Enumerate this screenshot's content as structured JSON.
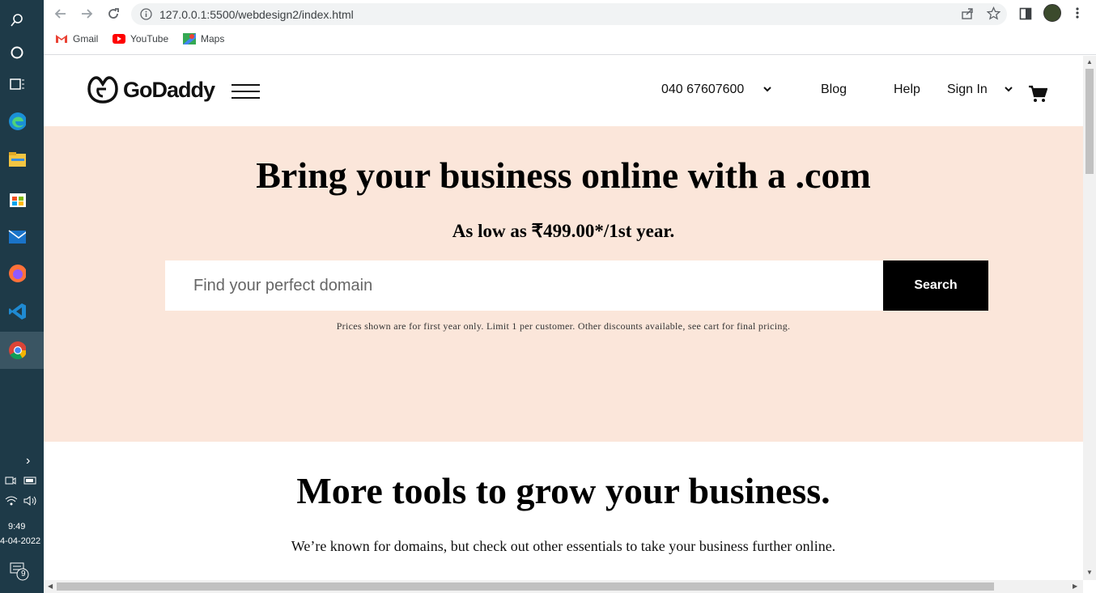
{
  "taskbar": {
    "time": "9:49",
    "date": "4-04-2022",
    "notification_count": "9"
  },
  "browser": {
    "url": "127.0.0.1:5500/webdesign2/index.html",
    "bookmarks": [
      {
        "label": "Gmail"
      },
      {
        "label": "YouTube"
      },
      {
        "label": "Maps"
      }
    ]
  },
  "header": {
    "logo": "GoDaddy",
    "phone": "040 67607600",
    "blog": "Blog",
    "help": "Help",
    "signin": "Sign In"
  },
  "hero": {
    "title": "Bring your business online with a .com",
    "subtitle": "As low as ₹499.00*/1st year.",
    "search_placeholder": "Find your perfect domain",
    "search_button": "Search",
    "disclaimer": "Prices shown are for first year only. Limit 1 per customer. Other discounts available, see cart for final pricing."
  },
  "tools": {
    "title": "More tools to grow your business.",
    "subtitle": "We’re known for domains, but check out other essentials to take your business further online."
  },
  "colors": {
    "hero_bg": "#fbe6da",
    "taskbar_bg": "#1e3a48",
    "button_bg": "#000000"
  }
}
